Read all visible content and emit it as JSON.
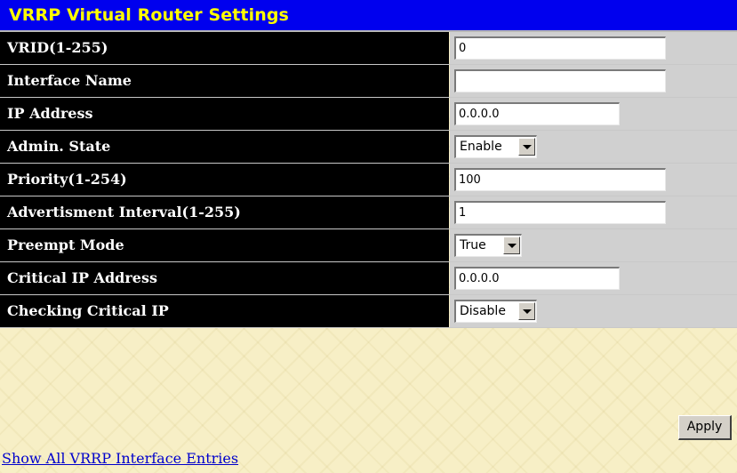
{
  "header": {
    "title": "VRRP Virtual Router Settings"
  },
  "form": {
    "rows": [
      {
        "label": "VRID(1-255)",
        "type": "text",
        "value": "0"
      },
      {
        "label": "Interface Name",
        "type": "text",
        "value": ""
      },
      {
        "label": "IP Address",
        "type": "text",
        "value": "0.0.0.0"
      },
      {
        "label": "Admin. State",
        "type": "select",
        "value": "Enable"
      },
      {
        "label": "Priority(1-254)",
        "type": "text",
        "value": "100"
      },
      {
        "label": "Advertisment Interval(1-255)",
        "type": "text",
        "value": "1"
      },
      {
        "label": "Preempt Mode",
        "type": "select",
        "value": "True"
      },
      {
        "label": "Critical IP Address",
        "type": "text",
        "value": "0.0.0.0"
      },
      {
        "label": "Checking Critical IP",
        "type": "select",
        "value": "Disable"
      }
    ]
  },
  "actions": {
    "apply_label": "Apply"
  },
  "footer": {
    "link_text": "Show All VRRP Interface Entries"
  },
  "colors": {
    "header_bg": "#0000ee",
    "header_text": "#ffff00",
    "label_bg": "#000000",
    "label_text": "#ffffff",
    "value_bg": "#d0d0d0",
    "link": "#0000cc"
  },
  "icons": {
    "dropdown": "chevron-down-icon"
  }
}
